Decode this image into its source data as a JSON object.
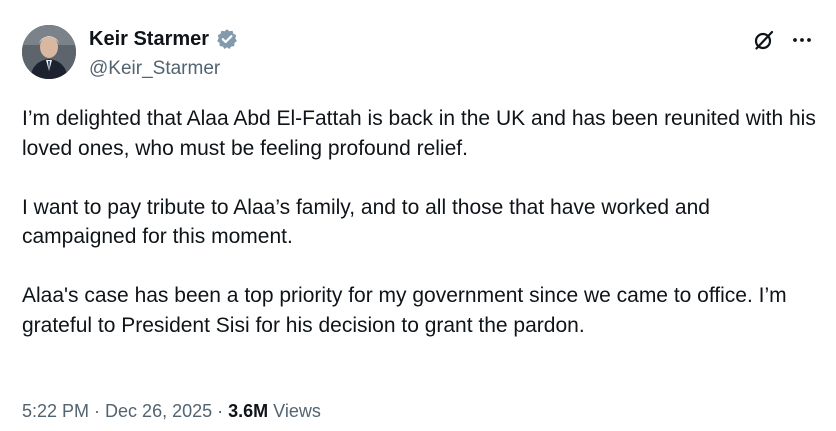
{
  "author": {
    "display_name": "Keir Starmer",
    "handle": "@Keir_Starmer",
    "verified": true,
    "verified_badge_color": "#829aab"
  },
  "actions": {
    "grok_icon": "slashed-circle-icon",
    "more_icon": "ellipsis-icon"
  },
  "tweet": {
    "paragraphs": [
      "I’m delighted that Alaa Abd El-Fattah is back in the UK and has been reunited with his loved ones, who must be feeling profound relief.",
      "I want to pay tribute to Alaa’s family, and to all those that have worked and campaigned for this moment.",
      "Alaa's case has been a top priority for my government since we came to office. I’m grateful to President Sisi for his decision to grant the pardon."
    ]
  },
  "meta": {
    "time": "5:22 PM",
    "separator": "·",
    "date": "Dec 26, 2025",
    "views_count": "3.6M",
    "views_label": "Views"
  },
  "colors": {
    "text_primary": "#0f1419",
    "text_secondary": "#536471"
  }
}
